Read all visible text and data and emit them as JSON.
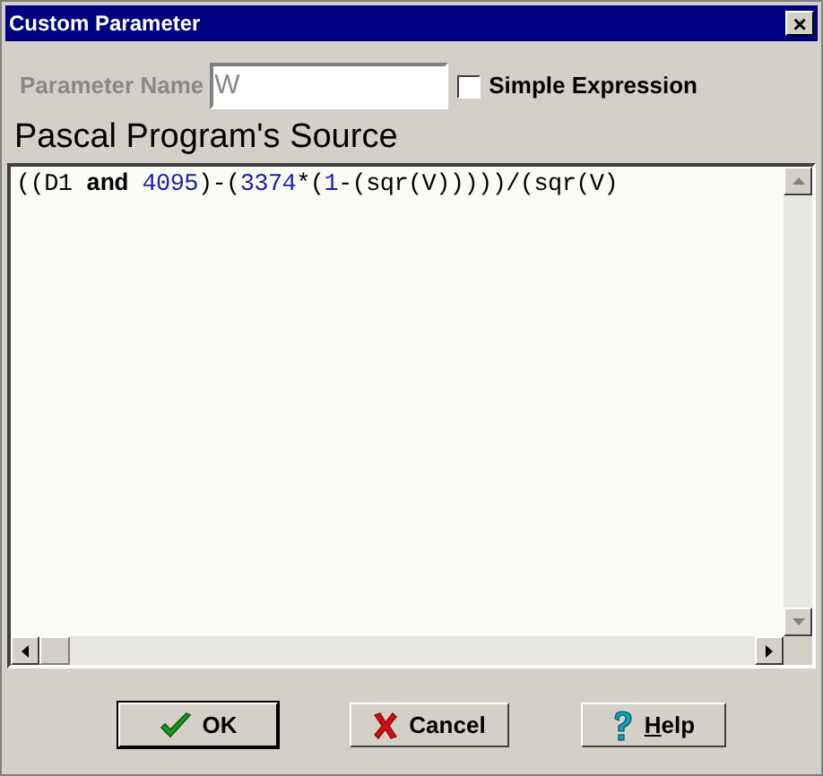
{
  "window": {
    "title": "Custom Parameter",
    "close": "×"
  },
  "parameter_name": {
    "label": "Parameter Name",
    "value": "W",
    "disabled": true
  },
  "simple_expression": {
    "label": "Simple Expression",
    "checked": false
  },
  "source": {
    "title": "Pascal Program's Source",
    "tokens": [
      {
        "kind": "plain",
        "text": "((D1 "
      },
      {
        "kind": "keyword",
        "text": "and "
      },
      {
        "kind": "number",
        "text": "4095"
      },
      {
        "kind": "plain",
        "text": ")-("
      },
      {
        "kind": "number",
        "text": "3374"
      },
      {
        "kind": "plain",
        "text": "*("
      },
      {
        "kind": "number",
        "text": "1"
      },
      {
        "kind": "plain",
        "text": "-(sqr(V)))))/(sqr(V)"
      }
    ]
  },
  "buttons": [
    {
      "kind": "ok",
      "label": "OK",
      "default": true,
      "underline_first": false
    },
    {
      "kind": "cancel",
      "label": "Cancel",
      "default": false,
      "underline_first": false
    },
    {
      "kind": "help",
      "label": "Help",
      "default": false,
      "underline_first": true
    }
  ]
}
